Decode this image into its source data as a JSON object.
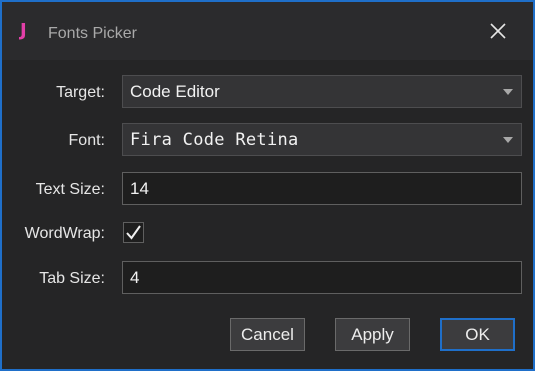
{
  "window": {
    "title": "Fonts Picker",
    "logo_letter": "J",
    "logo_color": "#e33fa8",
    "accent_color": "#1f6fc9",
    "close_icon": "close-icon"
  },
  "form": {
    "target": {
      "label": "Target:",
      "value": "Code Editor"
    },
    "font": {
      "label": "Font:",
      "value": "Fira Code Retina"
    },
    "text_size": {
      "label": "Text Size:",
      "value": "14"
    },
    "wordwrap": {
      "label": "WordWrap:",
      "checked": true
    },
    "tab_size": {
      "label": "Tab Size:",
      "value": "4"
    }
  },
  "buttons": {
    "cancel": "Cancel",
    "apply": "Apply",
    "ok": "OK"
  }
}
